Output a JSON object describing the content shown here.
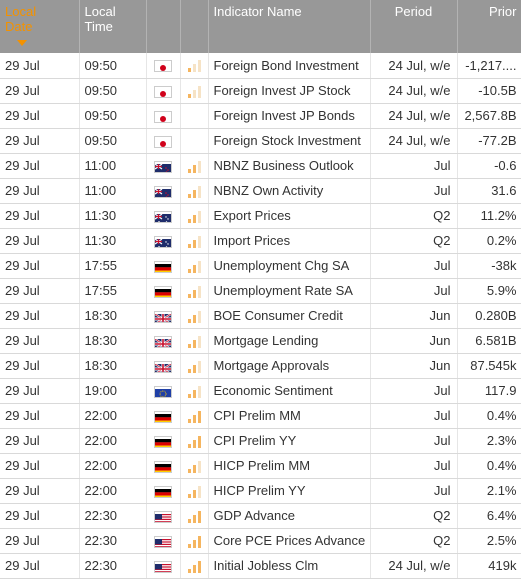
{
  "headers": {
    "date": "Local Date",
    "time": "Local Time",
    "flag": "",
    "importance": "",
    "indicator": "Indicator Name",
    "period": "Period",
    "prior": "Prior"
  },
  "colors": {
    "header_bg": "#989898",
    "sorted_header": "#f39200",
    "importance_bar": "#f5b55f"
  },
  "rows": [
    {
      "date": "29 Jul",
      "time": "09:50",
      "country": "JP",
      "importance": 1,
      "indicator": "Foreign Bond Investment",
      "period": "24 Jul, w/e",
      "prior": "-1,217...."
    },
    {
      "date": "29 Jul",
      "time": "09:50",
      "country": "JP",
      "importance": 1,
      "indicator": "Foreign Invest JP Stock",
      "period": "24 Jul, w/e",
      "prior": "-10.5B"
    },
    {
      "date": "29 Jul",
      "time": "09:50",
      "country": "JP",
      "importance": 0,
      "indicator": "Foreign Invest JP Bonds",
      "period": "24 Jul, w/e",
      "prior": "2,567.8B"
    },
    {
      "date": "29 Jul",
      "time": "09:50",
      "country": "JP",
      "importance": 0,
      "indicator": "Foreign Stock Investment",
      "period": "24 Jul, w/e",
      "prior": "-77.2B"
    },
    {
      "date": "29 Jul",
      "time": "11:00",
      "country": "NZ",
      "importance": 2,
      "indicator": "NBNZ Business Outlook",
      "period": "Jul",
      "prior": "-0.6"
    },
    {
      "date": "29 Jul",
      "time": "11:00",
      "country": "NZ",
      "importance": 2,
      "indicator": "NBNZ Own Activity",
      "period": "Jul",
      "prior": "31.6"
    },
    {
      "date": "29 Jul",
      "time": "11:30",
      "country": "AU",
      "importance": 2,
      "indicator": "Export Prices",
      "period": "Q2",
      "prior": "11.2%"
    },
    {
      "date": "29 Jul",
      "time": "11:30",
      "country": "AU",
      "importance": 2,
      "indicator": "Import Prices",
      "period": "Q2",
      "prior": "0.2%"
    },
    {
      "date": "29 Jul",
      "time": "17:55",
      "country": "DE",
      "importance": 2,
      "indicator": "Unemployment Chg SA",
      "period": "Jul",
      "prior": "-38k"
    },
    {
      "date": "29 Jul",
      "time": "17:55",
      "country": "DE",
      "importance": 2,
      "indicator": "Unemployment Rate SA",
      "period": "Jul",
      "prior": "5.9%"
    },
    {
      "date": "29 Jul",
      "time": "18:30",
      "country": "GB",
      "importance": 2,
      "indicator": "BOE Consumer Credit",
      "period": "Jun",
      "prior": "0.280B"
    },
    {
      "date": "29 Jul",
      "time": "18:30",
      "country": "GB",
      "importance": 2,
      "indicator": "Mortgage Lending",
      "period": "Jun",
      "prior": "6.581B"
    },
    {
      "date": "29 Jul",
      "time": "18:30",
      "country": "GB",
      "importance": 2,
      "indicator": "Mortgage Approvals",
      "period": "Jun",
      "prior": "87.545k"
    },
    {
      "date": "29 Jul",
      "time": "19:00",
      "country": "EU",
      "importance": 2,
      "indicator": "Economic Sentiment",
      "period": "Jul",
      "prior": "117.9"
    },
    {
      "date": "29 Jul",
      "time": "22:00",
      "country": "DE",
      "importance": 3,
      "indicator": "CPI Prelim MM",
      "period": "Jul",
      "prior": "0.4%"
    },
    {
      "date": "29 Jul",
      "time": "22:00",
      "country": "DE",
      "importance": 3,
      "indicator": "CPI Prelim YY",
      "period": "Jul",
      "prior": "2.3%"
    },
    {
      "date": "29 Jul",
      "time": "22:00",
      "country": "DE",
      "importance": 2,
      "indicator": "HICP Prelim MM",
      "period": "Jul",
      "prior": "0.4%"
    },
    {
      "date": "29 Jul",
      "time": "22:00",
      "country": "DE",
      "importance": 2,
      "indicator": "HICP Prelim YY",
      "period": "Jul",
      "prior": "2.1%"
    },
    {
      "date": "29 Jul",
      "time": "22:30",
      "country": "US",
      "importance": 3,
      "indicator": "GDP Advance",
      "period": "Q2",
      "prior": "6.4%"
    },
    {
      "date": "29 Jul",
      "time": "22:30",
      "country": "US",
      "importance": 3,
      "indicator": "Core PCE Prices Advance",
      "period": "Q2",
      "prior": "2.5%"
    },
    {
      "date": "29 Jul",
      "time": "22:30",
      "country": "US",
      "importance": 3,
      "indicator": "Initial Jobless Clm",
      "period": "24 Jul, w/e",
      "prior": "419k"
    }
  ]
}
